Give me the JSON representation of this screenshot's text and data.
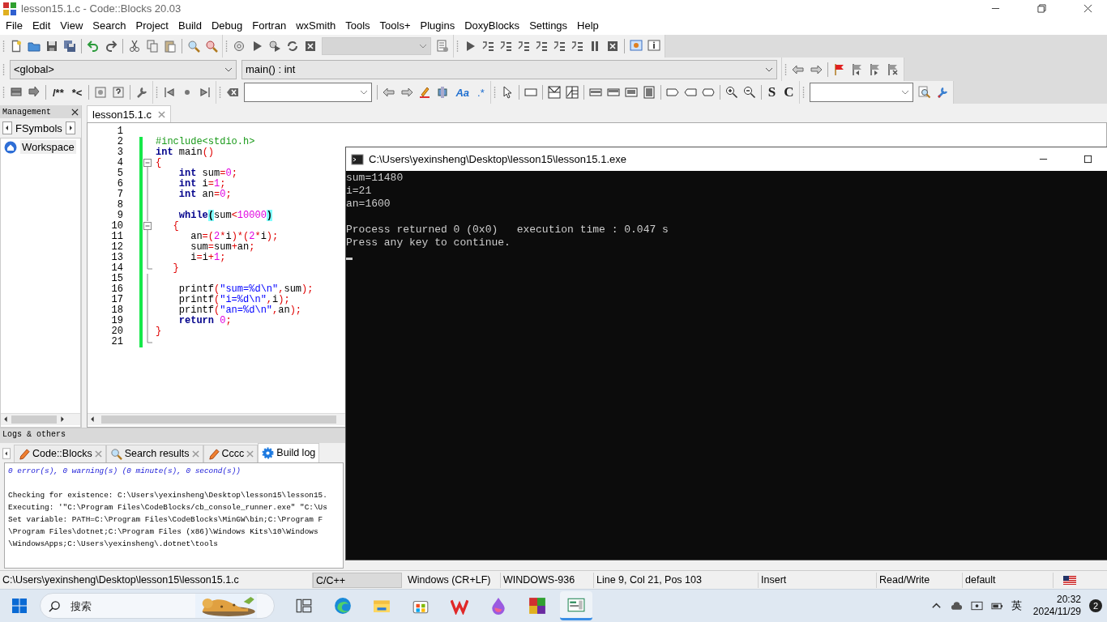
{
  "window": {
    "title": "lesson15.1.c - Code::Blocks 20.03"
  },
  "menu": [
    "File",
    "Edit",
    "View",
    "Search",
    "Project",
    "Build",
    "Debug",
    "Fortran",
    "wxSmith",
    "Tools",
    "Tools+",
    "Plugins",
    "DoxyBlocks",
    "Settings",
    "Help"
  ],
  "toolbar": {
    "combos": [
      "<global>",
      "main() : int"
    ],
    "labels": [
      "/**",
      "*<",
      "Aa",
      ".*",
      "S",
      "C"
    ]
  },
  "management": {
    "title": "Management",
    "tab": "FSymbols",
    "tree": [
      {
        "label": "Workspace",
        "selected": false
      }
    ]
  },
  "editor": {
    "tab": "lesson15.1.c",
    "lines": [
      {
        "number": "1",
        "changed": false,
        "kind": "none"
      },
      {
        "number": "2",
        "changed": true,
        "kind": "none",
        "tokens": [
          {
            "text": "#include<stdio.h>",
            "kind": "preproc"
          }
        ]
      },
      {
        "number": "3",
        "changed": true,
        "kind": "none",
        "tokens": [
          {
            "text": "int",
            "kind": "keyword"
          },
          {
            "text": " main",
            "kind": "plain"
          },
          {
            "text": "()",
            "kind": "operator"
          }
        ]
      },
      {
        "number": "4",
        "changed": true,
        "kind": "open",
        "tokens": [
          {
            "text": "{",
            "kind": "operator"
          }
        ]
      },
      {
        "number": "5",
        "changed": true,
        "kind": "line",
        "tokens": [
          {
            "text": "    int",
            "kind": "keyword"
          },
          {
            "text": " sum",
            "kind": "plain"
          },
          {
            "text": "=",
            "kind": "operator"
          },
          {
            "text": "0",
            "kind": "number"
          },
          {
            "text": ";",
            "kind": "operator"
          }
        ]
      },
      {
        "number": "6",
        "changed": true,
        "kind": "line",
        "tokens": [
          {
            "text": "    int",
            "kind": "keyword"
          },
          {
            "text": " i",
            "kind": "plain"
          },
          {
            "text": "=",
            "kind": "operator"
          },
          {
            "text": "1",
            "kind": "number"
          },
          {
            "text": ";",
            "kind": "operator"
          }
        ]
      },
      {
        "number": "7",
        "changed": true,
        "kind": "line",
        "tokens": [
          {
            "text": "    int",
            "kind": "keyword"
          },
          {
            "text": " an",
            "kind": "plain"
          },
          {
            "text": "=",
            "kind": "operator"
          },
          {
            "text": "0",
            "kind": "number"
          },
          {
            "text": ";",
            "kind": "operator"
          }
        ]
      },
      {
        "number": "8",
        "changed": true,
        "kind": "line"
      },
      {
        "number": "9",
        "changed": true,
        "kind": "line",
        "tokens": [
          {
            "text": "    while",
            "kind": "keyword"
          },
          {
            "text": "(",
            "kind": "match"
          },
          {
            "text": "sum",
            "kind": "plain"
          },
          {
            "text": "<",
            "kind": "operator"
          },
          {
            "text": "10000",
            "kind": "number"
          },
          {
            "text": ")",
            "kind": "match"
          }
        ]
      },
      {
        "number": "10",
        "changed": true,
        "kind": "open",
        "tokens": [
          {
            "text": "   {",
            "kind": "operator"
          }
        ]
      },
      {
        "number": "11",
        "changed": true,
        "kind": "line",
        "tokens": [
          {
            "text": "      an",
            "kind": "plain"
          },
          {
            "text": "=(",
            "kind": "operator"
          },
          {
            "text": "2",
            "kind": "number"
          },
          {
            "text": "*",
            "kind": "operator"
          },
          {
            "text": "i",
            "kind": "plain"
          },
          {
            "text": ")*(",
            "kind": "operator"
          },
          {
            "text": "2",
            "kind": "number"
          },
          {
            "text": "*",
            "kind": "operator"
          },
          {
            "text": "i",
            "kind": "plain"
          },
          {
            "text": ");",
            "kind": "operator"
          }
        ]
      },
      {
        "number": "12",
        "changed": true,
        "kind": "line",
        "tokens": [
          {
            "text": "      sum",
            "kind": "plain"
          },
          {
            "text": "=",
            "kind": "operator"
          },
          {
            "text": "sum",
            "kind": "plain"
          },
          {
            "text": "+",
            "kind": "operator"
          },
          {
            "text": "an",
            "kind": "plain"
          },
          {
            "text": ";",
            "kind": "operator"
          }
        ]
      },
      {
        "number": "13",
        "changed": true,
        "kind": "line",
        "tokens": [
          {
            "text": "      i",
            "kind": "plain"
          },
          {
            "text": "=",
            "kind": "operator"
          },
          {
            "text": "i",
            "kind": "plain"
          },
          {
            "text": "+",
            "kind": "operator"
          },
          {
            "text": "1",
            "kind": "number"
          },
          {
            "text": ";",
            "kind": "operator"
          }
        ]
      },
      {
        "number": "14",
        "changed": true,
        "kind": "end",
        "tokens": [
          {
            "text": "   }",
            "kind": "operator"
          }
        ]
      },
      {
        "number": "15",
        "changed": true,
        "kind": "line"
      },
      {
        "number": "16",
        "changed": true,
        "kind": "line",
        "tokens": [
          {
            "text": "    printf",
            "kind": "plain"
          },
          {
            "text": "(",
            "kind": "operator"
          },
          {
            "text": "\"sum=%d\\n\"",
            "kind": "string"
          },
          {
            "text": ",",
            "kind": "operator"
          },
          {
            "text": "sum",
            "kind": "plain"
          },
          {
            "text": ");",
            "kind": "operator"
          }
        ]
      },
      {
        "number": "17",
        "changed": true,
        "kind": "line",
        "tokens": [
          {
            "text": "    printf",
            "kind": "plain"
          },
          {
            "text": "(",
            "kind": "operator"
          },
          {
            "text": "\"i=%d\\n\"",
            "kind": "string"
          },
          {
            "text": ",",
            "kind": "operator"
          },
          {
            "text": "i",
            "kind": "plain"
          },
          {
            "text": ");",
            "kind": "operator"
          }
        ]
      },
      {
        "number": "18",
        "changed": true,
        "kind": "line",
        "tokens": [
          {
            "text": "    printf",
            "kind": "plain"
          },
          {
            "text": "(",
            "kind": "operator"
          },
          {
            "text": "\"an=%d\\n\"",
            "kind": "string"
          },
          {
            "text": ",",
            "kind": "operator"
          },
          {
            "text": "an",
            "kind": "plain"
          },
          {
            "text": ");",
            "kind": "operator"
          }
        ]
      },
      {
        "number": "19",
        "changed": true,
        "kind": "line",
        "tokens": [
          {
            "text": "    return",
            "kind": "keyword"
          },
          {
            "text": " 0",
            "kind": "number"
          },
          {
            "text": ";",
            "kind": "operator"
          }
        ]
      },
      {
        "number": "20",
        "changed": true,
        "kind": "line",
        "tokens": [
          {
            "text": "}",
            "kind": "operator"
          }
        ]
      },
      {
        "number": "21",
        "changed": true,
        "kind": "end"
      }
    ]
  },
  "logs": {
    "title": "Logs & others",
    "tabs": [
      {
        "label": "Code::Blocks",
        "kind": "pencil",
        "selected": false
      },
      {
        "label": "Search results",
        "kind": "search",
        "selected": false
      },
      {
        "label": "Cccc",
        "kind": "pencil",
        "selected": false
      },
      {
        "label": "Build log",
        "kind": "gear",
        "selected": true
      }
    ],
    "lines": [
      {
        "text": "0 error(s), 0 warning(s) (0 minute(s), 0 second(s))",
        "kind": "summary"
      },
      {
        "text": "Checking for existence: C:\\Users\\yexinsheng\\Desktop\\lesson15\\lesson15.",
        "kind": "plain"
      },
      {
        "text": "Executing: '\"C:\\Program Files\\CodeBlocks/cb_console_runner.exe\" \"C:\\Us",
        "kind": "plain"
      },
      {
        "text": "Set variable: PATH=C:\\Program Files\\CodeBlocks\\MinGW\\bin;C:\\Program F",
        "kind": "plain"
      },
      {
        "text": "\\Program Files\\dotnet;C:\\Program Files (x86)\\Windows Kits\\10\\Windows",
        "kind": "plain"
      },
      {
        "text": "\\WindowsApps;C:\\Users\\yexinsheng\\.dotnet\\tools",
        "kind": "plain"
      }
    ]
  },
  "console": {
    "title": "C:\\Users\\yexinsheng\\Desktop\\lesson15\\lesson15.1.exe",
    "output": [
      "sum=11480",
      "i=21",
      "an=1600"
    ],
    "status": [
      "Process returned 0 (0x0)   execution time : 0.047 s",
      "Press any key to continue."
    ]
  },
  "status_bar": [
    {
      "text": "C:\\Users\\yexinsheng\\Desktop\\lesson15\\lesson15.1.c",
      "kind": "plain"
    },
    {
      "text": "C/C++",
      "kind": "sunken"
    },
    {
      "text": "Windows (CR+LF)",
      "kind": "plain"
    },
    {
      "text": "WINDOWS-936",
      "kind": "plain"
    },
    {
      "text": "Line 9, Col 21, Pos 103",
      "kind": "plain"
    },
    {
      "text": "Insert",
      "kind": "plain"
    },
    {
      "text": "Read/Write",
      "kind": "plain"
    },
    {
      "text": "default",
      "kind": "plain"
    }
  ],
  "taskbar": {
    "search": {
      "placeholder": "搜索"
    },
    "apps": [
      {
        "kind": "taskview",
        "selected": false
      },
      {
        "kind": "edge",
        "selected": false
      },
      {
        "kind": "explorer",
        "selected": false
      },
      {
        "kind": "store",
        "selected": false
      },
      {
        "kind": "wps",
        "selected": false
      },
      {
        "kind": "drop",
        "selected": false
      },
      {
        "kind": "blocks",
        "selected": false
      },
      {
        "kind": "codeblocks",
        "selected": true
      }
    ],
    "ime": "英",
    "time": "20:32",
    "date": "2024/11/29",
    "notifications": "2"
  }
}
